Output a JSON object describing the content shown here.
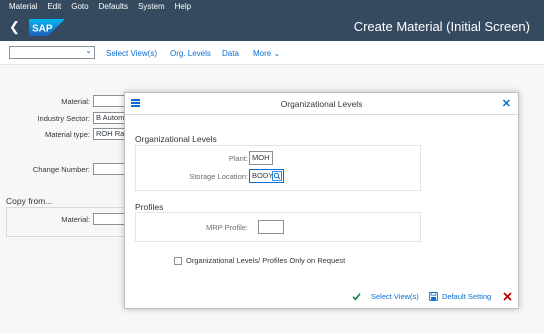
{
  "menubar": {
    "items": [
      "Material",
      "Edit",
      "Goto",
      "Defaults",
      "System",
      "Help"
    ]
  },
  "header": {
    "logo_text": "SAP",
    "title": "Create Material (Initial Screen)"
  },
  "toolbar": {
    "command_field_value": "",
    "buttons": [
      "Select View(s)",
      "Org. Levels",
      "Data",
      "More"
    ]
  },
  "background_form": {
    "material_label": "Material:",
    "material_value": "",
    "industry_sector_label": "Industry Sector:",
    "industry_sector_value": "B Autom",
    "material_type_label": "Material type:",
    "material_type_value": "ROH Raw",
    "change_number_label": "Change Number:",
    "change_number_value": "",
    "copy_from_title": "Copy from...",
    "copy_material_label": "Material:",
    "copy_material_value": ""
  },
  "dialog": {
    "title": "Organizational Levels",
    "org_section_title": "Organizational Levels",
    "plant_label": "Plant:",
    "plant_value": "MOH",
    "storage_location_label": "Storage Location:",
    "storage_location_value": "BODY",
    "profiles_section_title": "Profiles",
    "mrp_profile_label": "MRP Profile:",
    "mrp_profile_value": "",
    "checkbox_label": "Organizational Levels/ Profiles Only on Request",
    "checkbox_checked": false,
    "footer": {
      "select_views": "Select View(s)",
      "default_setting": "Default Setting"
    }
  },
  "colors": {
    "shell": "#354a5f",
    "accent": "#0a6ed1",
    "confirm": "#107e3e",
    "cancel": "#bb0000"
  }
}
